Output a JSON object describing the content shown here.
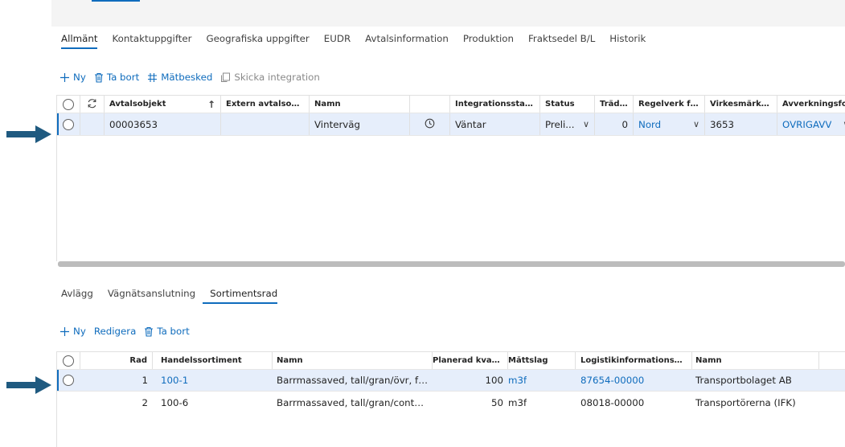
{
  "main_tabs": [
    {
      "label": "Allmänt",
      "active": true
    },
    {
      "label": "Kontaktuppgifter",
      "active": false
    },
    {
      "label": "Geografiska uppgifter",
      "active": false
    },
    {
      "label": "EUDR",
      "active": false
    },
    {
      "label": "Avtalsinformation",
      "active": false
    },
    {
      "label": "Produktion",
      "active": false
    },
    {
      "label": "Fraktsedel B/L",
      "active": false
    },
    {
      "label": "Historik",
      "active": false
    }
  ],
  "top_actions": {
    "new": "Ny",
    "delete": "Ta bort",
    "measure": "Mätbesked",
    "send": "Skicka integration"
  },
  "top_grid": {
    "headers": {
      "object": "Avtalsobjekt",
      "external": "Extern avtalsobjek...",
      "name": "Namn",
      "integration": "Integrationsstatus",
      "status": "Status",
      "trees": "Trädå...",
      "rules": "Regelverk för ...",
      "marking": "Virkesmärkning",
      "form": "Avverkningsform"
    },
    "rows": [
      {
        "object": "00003653",
        "external": "",
        "name": "Vinterväg",
        "integration": "Väntar",
        "status": "Preli...",
        "trees": "0",
        "rules": "Nord",
        "marking": "3653",
        "form": "OVRIGAVV"
      }
    ]
  },
  "sub_tabs": [
    {
      "label": "Avlägg",
      "active": false
    },
    {
      "label": "Vägnätsanslutning",
      "active": false
    },
    {
      "label": "Sortimentsrad",
      "active": true
    }
  ],
  "sub_actions": {
    "new": "Ny",
    "edit": "Redigera",
    "delete": "Ta bort"
  },
  "sub_grid": {
    "headers": {
      "row": "Rad",
      "assortment": "Handelssortiment",
      "name": "Namn",
      "planned": "Planerad kvant...",
      "unit": "Måttslag",
      "logistics": "Logistikinformationsmott...",
      "name2": "Namn"
    },
    "rows": [
      {
        "row": "1",
        "assortment": "100-1",
        "name": "Barrmassaved, tall/gran/övr, fall...",
        "planned": "100",
        "unit": "m3f",
        "logistics": "87654-00000",
        "name2": "Transportbolaget AB"
      },
      {
        "row": "2",
        "assortment": "100-6",
        "name": "Barrmassaved, tall/gran/contort...",
        "planned": "50",
        "unit": "m3f",
        "logistics": "08018-00000",
        "name2": "Transportörerna (IFK)"
      }
    ]
  },
  "colors": {
    "accent": "#0f6cbd",
    "arrow": "#1f5a80",
    "selected_row": "#e6eefb"
  }
}
